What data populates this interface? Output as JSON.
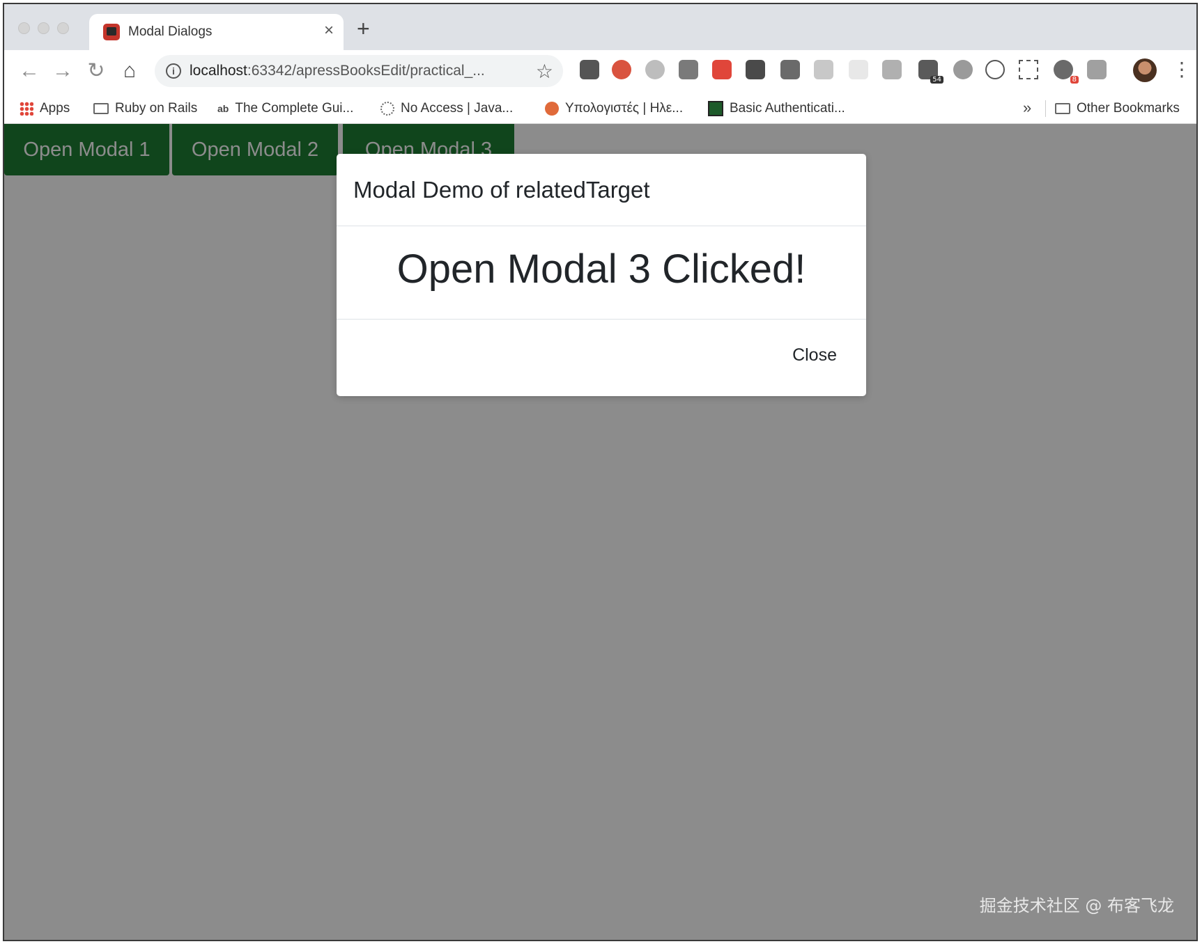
{
  "browser": {
    "tab": {
      "title": "Modal Dialogs",
      "close_glyph": "×"
    },
    "new_tab_glyph": "+",
    "toolbar": {
      "back_glyph": "←",
      "forward_glyph": "→",
      "reload_glyph": "↻",
      "home_glyph": "⌂",
      "url_host": "localhost",
      "url_rest": ":63342/apressBooksEdit/practical_...",
      "star_glyph": "☆",
      "menu_glyph": "⋮",
      "extension_badges": {
        "notes": "54",
        "alerts": "8"
      }
    },
    "bookmarks": {
      "items": [
        {
          "label": "Apps"
        },
        {
          "label": "Ruby on Rails"
        },
        {
          "label": "The Complete Gui..."
        },
        {
          "label": "No Access | Java..."
        },
        {
          "label": "Υπολογιστές | Ηλε..."
        },
        {
          "label": "Basic Authenticati..."
        }
      ],
      "more_glyph": "»",
      "other_label": "Other Bookmarks"
    }
  },
  "page": {
    "buttons": [
      {
        "label": "Open Modal 1"
      },
      {
        "label": "Open Modal 2"
      },
      {
        "label": "Open Modal 3"
      }
    ],
    "modal": {
      "title": "Modal Demo of relatedTarget",
      "body": "Open Modal 3 Clicked!",
      "close_label": "Close"
    }
  },
  "watermark": "掘金技术社区 @ 布客飞龙",
  "colors": {
    "button_green": "#1e7e34",
    "backdrop": "rgba(0,0,0,0.45)",
    "tab_strip": "#dee1e6"
  }
}
